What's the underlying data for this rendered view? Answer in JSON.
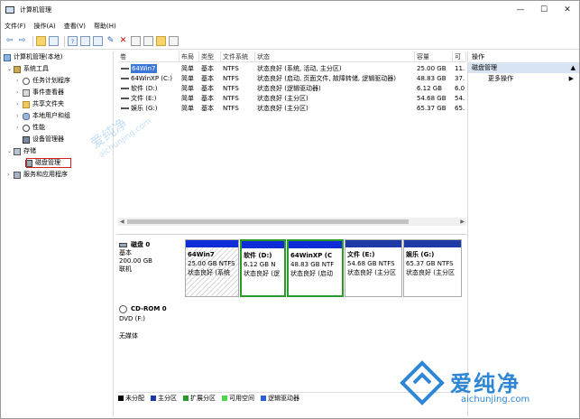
{
  "window": {
    "title": "计算机管理",
    "min": "—",
    "max": "☐",
    "close": "✕"
  },
  "menu": [
    "文件(F)",
    "操作(A)",
    "查看(V)",
    "帮助(H)"
  ],
  "tree": {
    "root": "计算机管理(本地)",
    "system_tools": "系统工具",
    "task_scheduler": "任务计划程序",
    "event_viewer": "事件查看器",
    "shared_folders": "共享文件夹",
    "local_users": "本地用户和组",
    "performance": "性能",
    "device_manager": "设备管理器",
    "storage": "存储",
    "disk_management": "磁盘管理",
    "services_apps": "服务和应用程序"
  },
  "volume_list": {
    "headers": [
      "卷",
      "布局",
      "类型",
      "文件系统",
      "状态",
      "容量",
      "可"
    ],
    "rows": [
      {
        "vol": "64Win7",
        "layout": "简单",
        "type": "基本",
        "fs": "NTFS",
        "status": "状态良好 (系统, 活动, 主分区)",
        "cap": "25.00 GB",
        "free": "11.",
        "selected": true
      },
      {
        "vol": "64WinXP (C:)",
        "layout": "简单",
        "type": "基本",
        "fs": "NTFS",
        "status": "状态良好 (启动, 页面文件, 故障转储, 逻辑驱动器)",
        "cap": "48.83 GB",
        "free": "37.",
        "selected": false
      },
      {
        "vol": "软件 (D:)",
        "layout": "简单",
        "type": "基本",
        "fs": "NTFS",
        "status": "状态良好 (逻辑驱动器)",
        "cap": "6.12 GB",
        "free": "6.0",
        "selected": false
      },
      {
        "vol": "文件 (E:)",
        "layout": "简单",
        "type": "基本",
        "fs": "NTFS",
        "status": "状态良好 (主分区)",
        "cap": "54.68 GB",
        "free": "54.",
        "selected": false
      },
      {
        "vol": "娱乐 (G:)",
        "layout": "简单",
        "type": "基本",
        "fs": "NTFS",
        "status": "状态良好 (主分区)",
        "cap": "65.37 GB",
        "free": "65.",
        "selected": false
      }
    ]
  },
  "disk0": {
    "name": "磁盘 0",
    "type": "基本",
    "size": "200.00 GB",
    "state": "联机",
    "partitions": [
      {
        "name": "64Win7",
        "size": "25.00 GB NTFS",
        "status": "状态良好 (系统",
        "style": "hatch"
      },
      {
        "name": "软件 (D:)",
        "size": "6.12 GB N",
        "status": "状态良好 (逻",
        "style": "ext"
      },
      {
        "name": "64WinXP (C",
        "size": "48.83 GB NTF",
        "status": "状态良好 (启动",
        "style": "ext"
      },
      {
        "name": "文件 (E:)",
        "size": "54.68 GB NTFS",
        "status": "状态良好 (主分区",
        "style": "plain"
      },
      {
        "name": "娱乐 (G:)",
        "size": "65.37 GB NTFS",
        "status": "状态良好 (主分区",
        "style": "plain"
      }
    ]
  },
  "cdrom": {
    "name": "CD-ROM 0",
    "drive": "DVD (F:)",
    "media": "无媒体"
  },
  "legend": [
    {
      "label": "未分配",
      "color": "#000000"
    },
    {
      "label": "主分区",
      "color": "#1f3aa8"
    },
    {
      "label": "扩展分区",
      "color": "#2a9a2a"
    },
    {
      "label": "可用空间",
      "color": "#4bd84b"
    },
    {
      "label": "逻辑驱动器",
      "color": "#2b5fd9"
    }
  ],
  "actions": {
    "header": "操作",
    "section": "磁盘管理",
    "more": "更多操作"
  },
  "watermark": {
    "brand": "爱纯净",
    "url": "aichunjing.com",
    "faint": "爱纯净",
    "faint_url": "aichunjing.com"
  }
}
